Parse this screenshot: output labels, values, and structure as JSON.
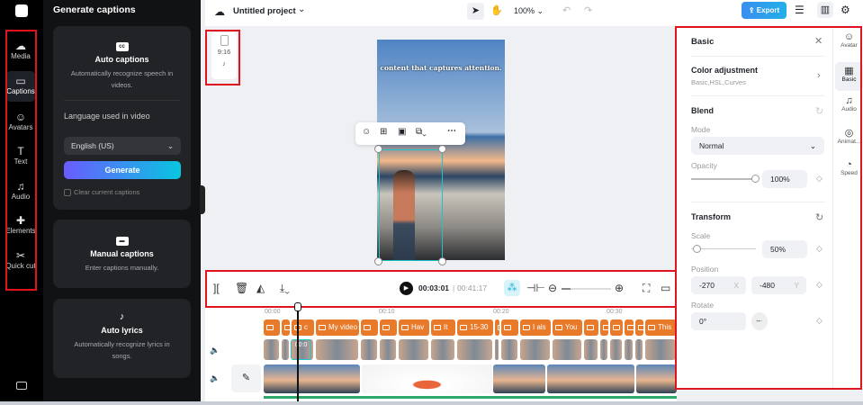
{
  "rail": {
    "items": [
      {
        "label": "Media",
        "icon": "cloud-upload-icon"
      },
      {
        "label": "Captions",
        "icon": "captions-icon",
        "active": true
      },
      {
        "label": "Avatars",
        "icon": "avatar-icon"
      },
      {
        "label": "Text",
        "icon": "text-icon"
      },
      {
        "label": "Audio",
        "icon": "music-icon"
      },
      {
        "label": "Elements",
        "icon": "elements-icon"
      },
      {
        "label": "Quick cut",
        "icon": "quick-cut-icon"
      }
    ]
  },
  "panel": {
    "title": "Generate captions",
    "auto": {
      "title": "Auto captions",
      "desc": "Automatically recognize speech in videos.",
      "lang_label": "Language used in video",
      "lang_value": "English (US)",
      "generate": "Generate",
      "clear": "Clear current captions"
    },
    "manual": {
      "title": "Manual captions",
      "desc": "Enter captions manually."
    },
    "lyrics": {
      "title": "Auto lyrics",
      "desc": "Automatically recognize lyrics in songs."
    }
  },
  "topbar": {
    "project": "Untitled project",
    "zoom": "100%",
    "export": "Export"
  },
  "canvas": {
    "ratio": "9:16",
    "caption": "content that captures attention."
  },
  "timeline": {
    "current": "00:03:01",
    "total": "00:41:17",
    "ticks": [
      "00:00",
      "00:10",
      "00:20",
      "00:30"
    ],
    "captions": [
      "",
      "",
      "c",
      "My video",
      "",
      "",
      "Hav",
      "It",
      "15-30",
      "",
      "",
      "I als",
      "You",
      "",
      "",
      "",
      "",
      "",
      "This"
    ],
    "playhead_clip": "00:0"
  },
  "right": {
    "title": "Basic",
    "color_adj": "Color adjustment",
    "color_sub": "Basic,HSL,Curves",
    "blend": "Blend",
    "mode_label": "Mode",
    "mode": "Normal",
    "opacity_label": "Opacity",
    "opacity": "100%",
    "opacity_pct": 100,
    "transform": "Transform",
    "scale_label": "Scale",
    "scale": "50%",
    "scale_pct": 50,
    "position_label": "Position",
    "pos_x": "-270",
    "pos_y": "-480",
    "x": "X",
    "y": "Y",
    "rotate_label": "Rotate",
    "rotate": "0°"
  },
  "tabs": [
    {
      "label": "Avatar"
    },
    {
      "label": "Basic",
      "active": true
    },
    {
      "label": "Audio"
    },
    {
      "label": "Animat..."
    },
    {
      "label": "Speed"
    }
  ],
  "colors": {
    "caption_clip": "#e87a2a",
    "accent": "#00c4cc",
    "highlight": "#e0141e"
  }
}
